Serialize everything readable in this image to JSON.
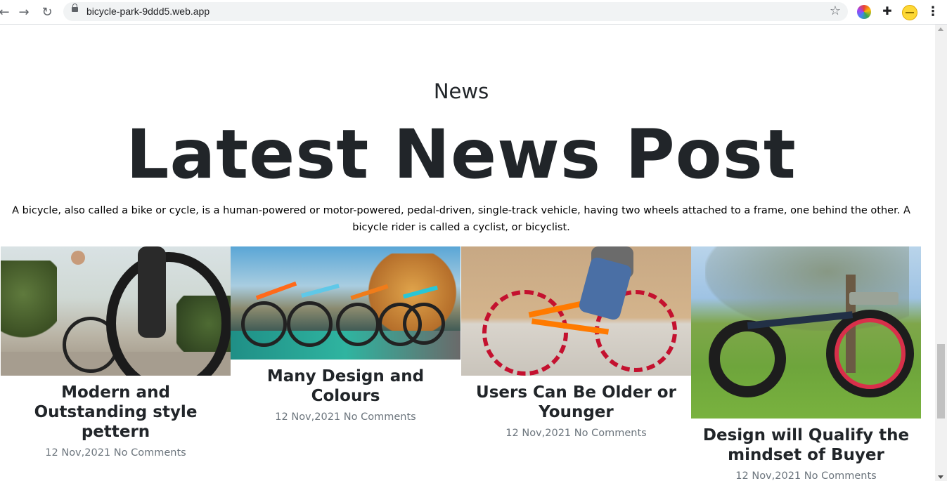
{
  "browser": {
    "url": "bicycle-park-9ddd5.web.app"
  },
  "section": {
    "eyebrow": "News",
    "title": "Latest News Post",
    "intro": "A bicycle, also called a bike or cycle, is a human-powered or motor-powered, pedal-driven, single-track vehicle, having two wheels attached to a frame, one behind the other. A bicycle rider is called a cyclist, or bicyclist."
  },
  "posts": [
    {
      "title": "Modern and Outstanding style pettern",
      "date": "12 Nov,2021",
      "comments": "No Comments"
    },
    {
      "title": "Many Design and Colours",
      "date": "12 Nov,2021",
      "comments": "No Comments"
    },
    {
      "title": "Users Can Be Older or Younger",
      "date": "12 Nov,2021",
      "comments": "No Comments"
    },
    {
      "title": "Design will Qualify the mindset of Buyer",
      "date": "12 Nov,2021",
      "comments": "No Comments"
    }
  ]
}
